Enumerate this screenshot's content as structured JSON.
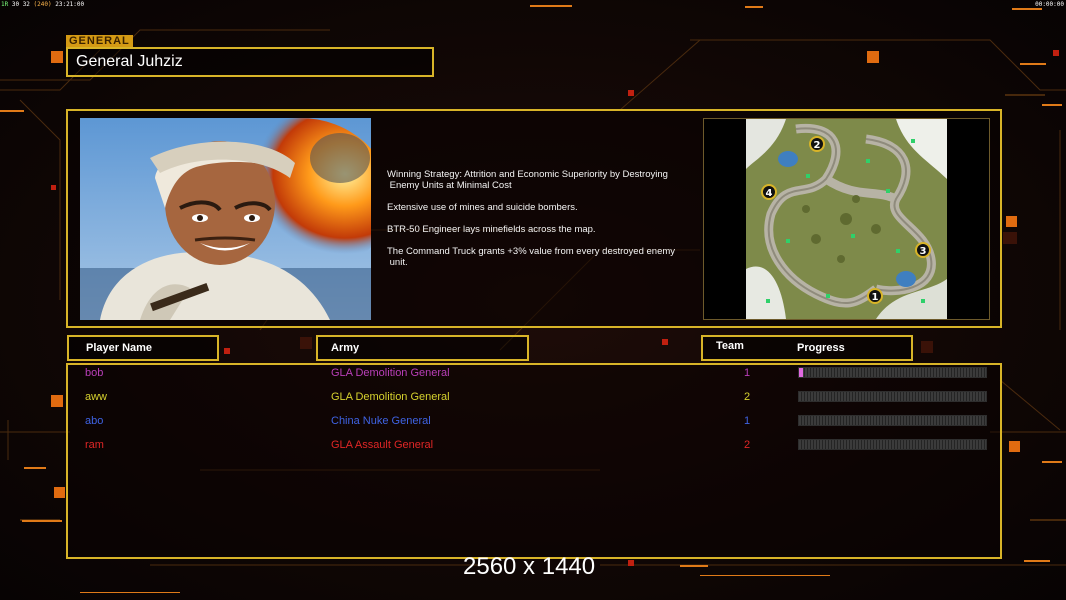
{
  "hud": {
    "left": {
      "g": "1R",
      "a": "30 32",
      "o": "(240)",
      "time": "23:21:00"
    },
    "right": "00:00:00"
  },
  "general": {
    "tag": "GENERAL",
    "name": "General Juhziz",
    "strategy": [
      "Winning Strategy: Attrition and Economic Superiority by Destroying\n Enemy Units at Minimal Cost",
      "Extensive use of mines and suicide bombers.",
      "BTR-50 Engineer lays minefields across the map.",
      "The Command Truck grants +3% value from every destroyed enemy\n unit."
    ]
  },
  "map": {
    "slots": [
      "1",
      "2",
      "3",
      "4"
    ]
  },
  "table": {
    "headers": {
      "player": "Player Name",
      "army": "Army",
      "team": "Team",
      "progress": "Progress"
    },
    "rows": [
      {
        "player": "bob",
        "army": "GLA Demolition General",
        "team": "1",
        "color": "#b93fb9",
        "progress": 0.02
      },
      {
        "player": "aww",
        "army": "GLA Demolition General",
        "team": "2",
        "color": "#d6d22e",
        "progress": 0
      },
      {
        "player": "abo",
        "army": "China Nuke General",
        "team": "1",
        "color": "#3f63e3",
        "progress": 0
      },
      {
        "player": "ram",
        "army": "GLA Assault General",
        "team": "2",
        "color": "#e02626",
        "progress": 0
      }
    ]
  },
  "overlay": {
    "resolution": "2560 x 1440"
  }
}
